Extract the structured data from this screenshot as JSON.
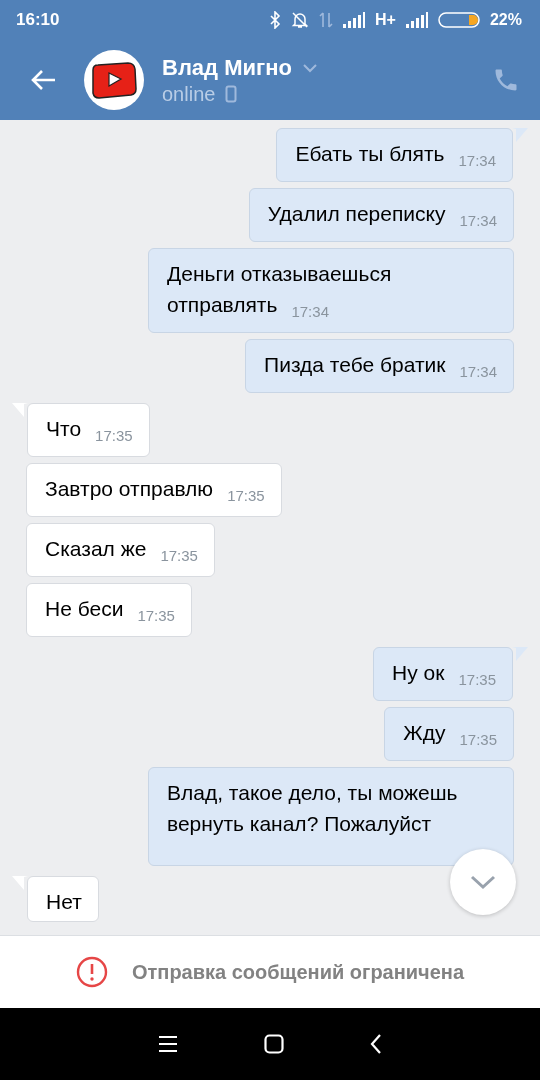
{
  "status_bar": {
    "time": "16:10",
    "network": "H+",
    "battery": "22%"
  },
  "header": {
    "name": "Влад Мигно",
    "status": "online"
  },
  "messages": [
    {
      "kind": "out",
      "text": "Ебать ты блять",
      "time": "17:34"
    },
    {
      "kind": "out",
      "text": "Удалил переписку",
      "time": "17:34"
    },
    {
      "kind": "out",
      "text": "Деньги отказываешься отправлять",
      "time": "17:34"
    },
    {
      "kind": "out",
      "text": "Пизда тебе братик",
      "time": "17:34"
    },
    {
      "kind": "in",
      "text": "Что",
      "time": "17:35"
    },
    {
      "kind": "in",
      "text": "Завтро отправлю",
      "time": "17:35"
    },
    {
      "kind": "in",
      "text": "Сказал же",
      "time": "17:35"
    },
    {
      "kind": "in",
      "text": "Не беси",
      "time": "17:35"
    },
    {
      "kind": "out",
      "text": "Ну ок",
      "time": "17:35"
    },
    {
      "kind": "out",
      "text": "Жду",
      "time": "17:35"
    },
    {
      "kind": "out",
      "text": "Влад, такое дело, ты можешь вернуть канал? Пожалуйст"
    },
    {
      "kind": "in",
      "text": "Нет"
    }
  ],
  "notice": "Отправка сообщений ограничена"
}
